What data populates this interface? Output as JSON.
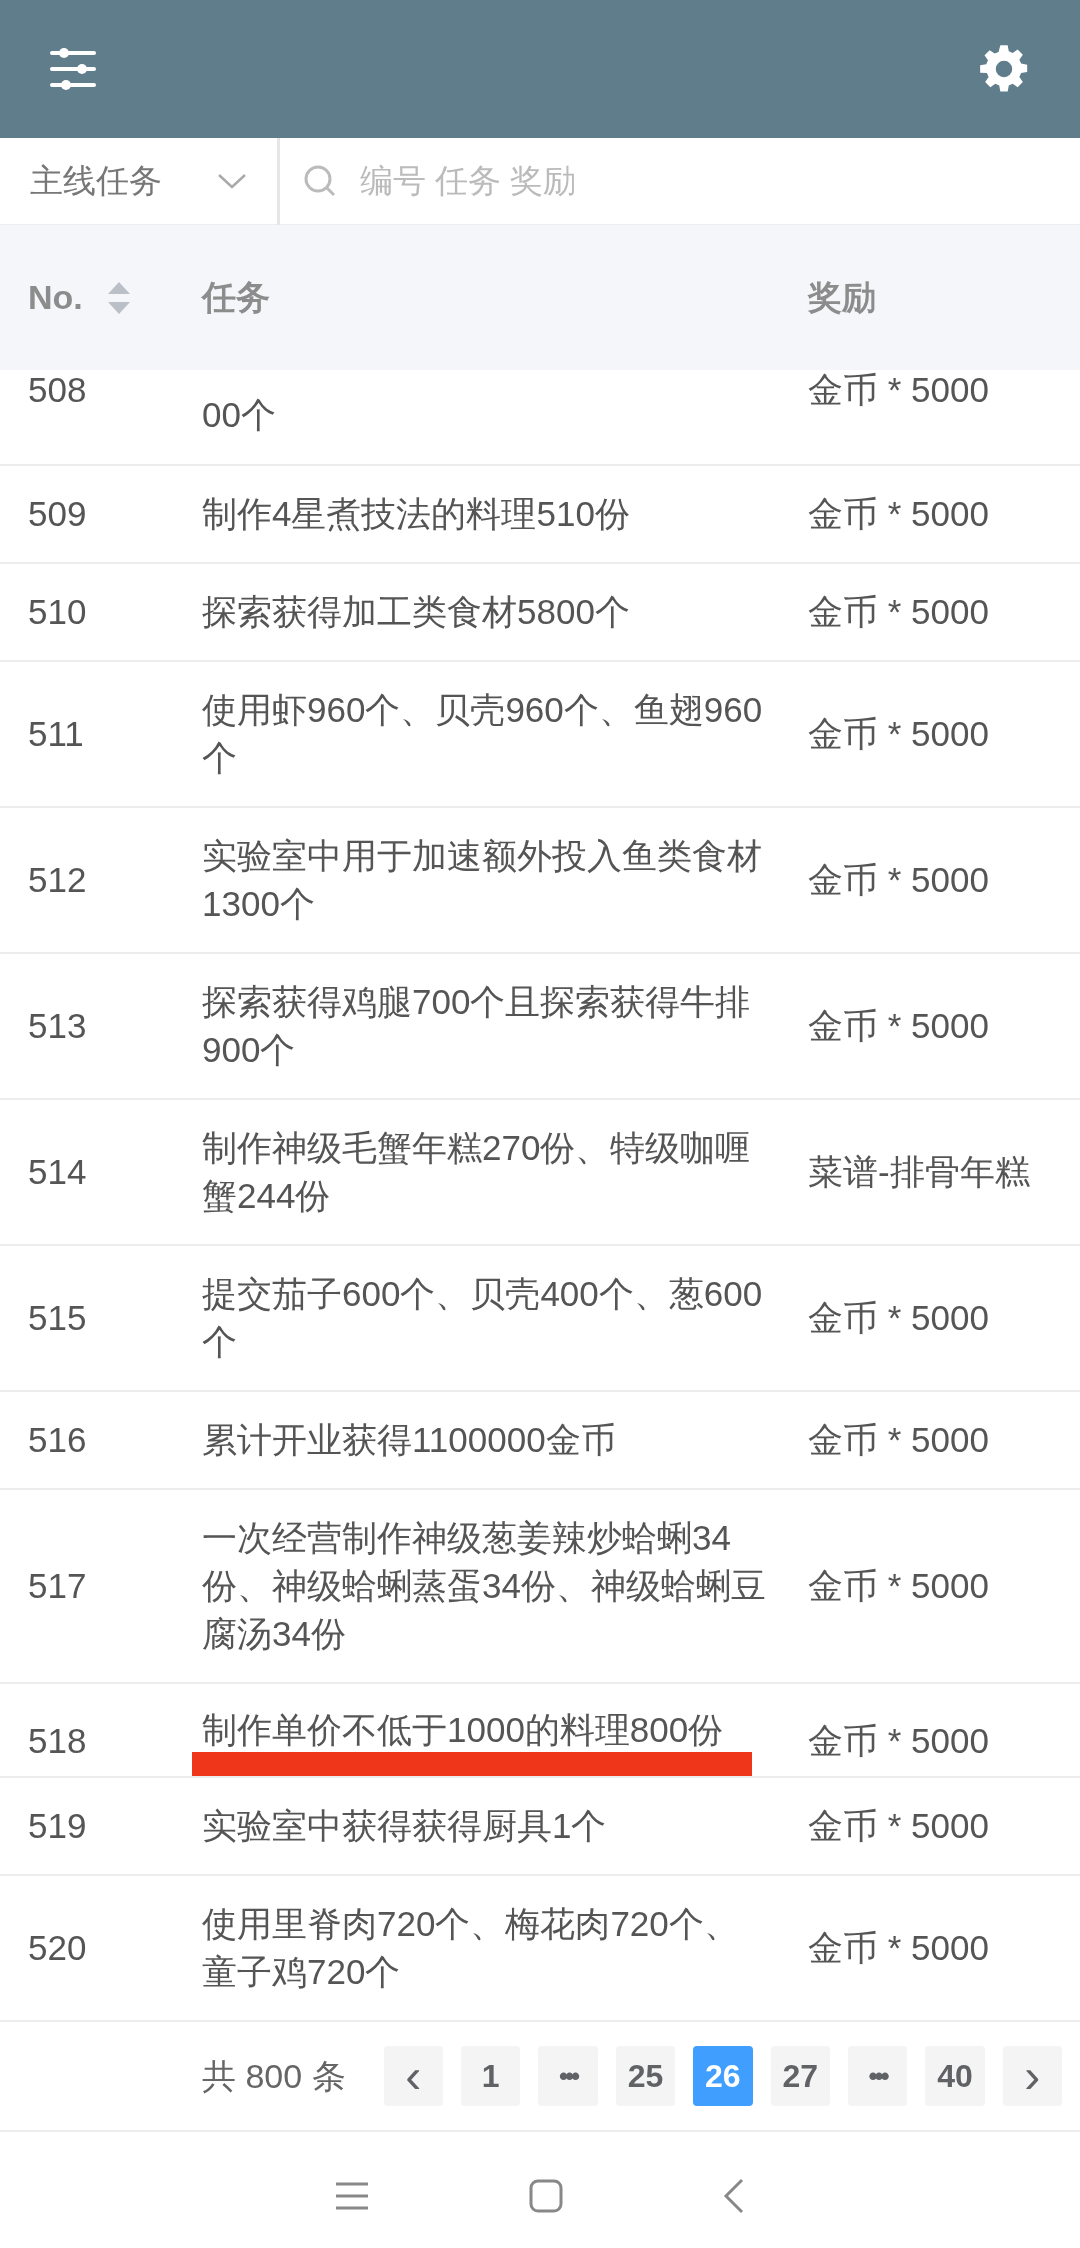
{
  "filter": {
    "category": "主线任务",
    "search_placeholder": "编号 任务 奖励"
  },
  "table": {
    "columns": [
      "No.",
      "任务",
      "奖励"
    ],
    "rows": [
      {
        "no": "508",
        "task": "00个",
        "reward": "金币 * 5000",
        "cut": true,
        "underlined": false
      },
      {
        "no": "509",
        "task": "制作4星煮技法的料理510份",
        "reward": "金币 * 5000",
        "cut": false,
        "underlined": false
      },
      {
        "no": "510",
        "task": "探索获得加工类食材5800个",
        "reward": "金币 * 5000",
        "cut": false,
        "underlined": false
      },
      {
        "no": "511",
        "task": "使用虾960个、贝壳960个、鱼翅960个",
        "reward": "金币 * 5000",
        "cut": false,
        "underlined": false
      },
      {
        "no": "512",
        "task": "实验室中用于加速额外投入鱼类食材1300个",
        "reward": "金币 * 5000",
        "cut": false,
        "underlined": false
      },
      {
        "no": "513",
        "task": "探索获得鸡腿700个且探索获得牛排900个",
        "reward": "金币 * 5000",
        "cut": false,
        "underlined": false
      },
      {
        "no": "514",
        "task": "制作神级毛蟹年糕270份、特级咖喱蟹244份",
        "reward": "菜谱-排骨年糕",
        "cut": false,
        "underlined": false
      },
      {
        "no": "515",
        "task": "提交茄子600个、贝壳400个、葱600个",
        "reward": "金币 * 5000",
        "cut": false,
        "underlined": false
      },
      {
        "no": "516",
        "task": "累计开业获得1100000金币",
        "reward": "金币 * 5000",
        "cut": false,
        "underlined": false
      },
      {
        "no": "517",
        "task": "一次经营制作神级葱姜辣炒蛤蜊34份、神级蛤蜊蒸蛋34份、神级蛤蜊豆腐汤34份",
        "reward": "金币 * 5000",
        "cut": false,
        "underlined": false
      },
      {
        "no": "518",
        "task": "制作单价不低于1000的料理800份",
        "reward": "金币 * 5000",
        "cut": false,
        "underlined": true
      },
      {
        "no": "519",
        "task": "实验室中获得获得厨具1个",
        "reward": "金币 * 5000",
        "cut": false,
        "underlined": false
      },
      {
        "no": "520",
        "task": "使用里脊肉720个、梅花肉720个、童子鸡720个",
        "reward": "金币 * 5000",
        "cut": false,
        "underlined": false
      }
    ]
  },
  "pagination": {
    "total": "共 800 条",
    "pages": [
      {
        "kind": "prev",
        "label": "‹",
        "selected": false
      },
      {
        "kind": "page",
        "label": "1",
        "selected": false
      },
      {
        "kind": "more",
        "label": "•••",
        "selected": false
      },
      {
        "kind": "page",
        "label": "25",
        "selected": false
      },
      {
        "kind": "page",
        "label": "26",
        "selected": true
      },
      {
        "kind": "page",
        "label": "27",
        "selected": false
      },
      {
        "kind": "more",
        "label": "•••",
        "selected": false
      },
      {
        "kind": "page",
        "label": "40",
        "selected": false
      },
      {
        "kind": "next",
        "label": "›",
        "selected": false
      }
    ]
  }
}
